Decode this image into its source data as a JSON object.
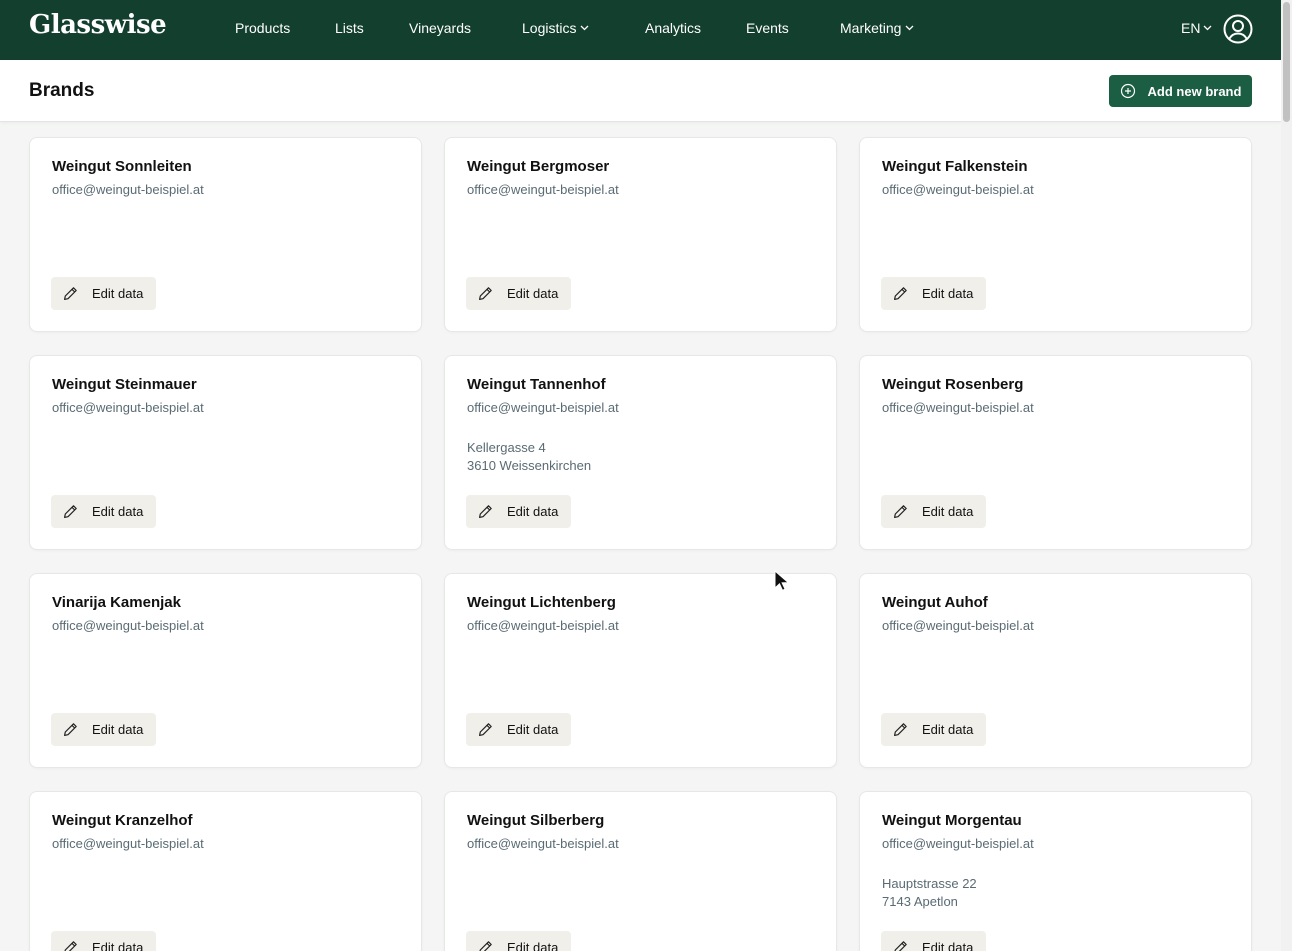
{
  "app": {
    "logo": "Glasswise"
  },
  "nav": {
    "items": [
      {
        "label": "Products",
        "has_menu": false
      },
      {
        "label": "Lists",
        "has_menu": false
      },
      {
        "label": "Vineyards",
        "has_menu": false
      },
      {
        "label": "Logistics",
        "has_menu": true
      },
      {
        "label": "Analytics",
        "has_menu": false
      },
      {
        "label": "Events",
        "has_menu": false
      },
      {
        "label": "Marketing",
        "has_menu": true
      }
    ],
    "language": "EN",
    "avatar_icon": "user-circle-icon"
  },
  "header": {
    "title": "Brands",
    "add_button_label": "Add new brand",
    "add_button_icon": "plus-circle-icon"
  },
  "colors": {
    "nav_bg": "#133f2e",
    "accent": "#1b5e43",
    "muted_text": "#5a6b74",
    "edit_button_bg": "#f1efe9"
  },
  "edit_label": "Edit data",
  "edit_icon": "pencil-icon",
  "brands": [
    {
      "name": "Weingut Sonnleiten",
      "email": "office@weingut-beispiel.at",
      "address_line1": "",
      "address_line2": ""
    },
    {
      "name": "Weingut Bergmoser",
      "email": "office@weingut-beispiel.at",
      "address_line1": "",
      "address_line2": ""
    },
    {
      "name": "Weingut Falkenstein",
      "email": "office@weingut-beispiel.at",
      "address_line1": "",
      "address_line2": ""
    },
    {
      "name": "Weingut Steinmauer",
      "email": "office@weingut-beispiel.at",
      "address_line1": "",
      "address_line2": ""
    },
    {
      "name": "Weingut Tannenhof",
      "email": "office@weingut-beispiel.at",
      "address_line1": "Kellergasse 4",
      "address_line2": "3610 Weissenkirchen"
    },
    {
      "name": "Weingut Rosenberg",
      "email": "office@weingut-beispiel.at",
      "address_line1": "",
      "address_line2": ""
    },
    {
      "name": "Vinarija Kamenjak",
      "email": "office@weingut-beispiel.at",
      "address_line1": "",
      "address_line2": ""
    },
    {
      "name": "Weingut Lichtenberg",
      "email": "office@weingut-beispiel.at",
      "address_line1": "",
      "address_line2": ""
    },
    {
      "name": "Weingut Auhof",
      "email": "office@weingut-beispiel.at",
      "address_line1": "",
      "address_line2": ""
    },
    {
      "name": "Weingut Kranzelhof",
      "email": "office@weingut-beispiel.at",
      "address_line1": "",
      "address_line2": ""
    },
    {
      "name": "Weingut Silberberg",
      "email": "office@weingut-beispiel.at",
      "address_line1": "",
      "address_line2": ""
    },
    {
      "name": "Weingut Morgentau",
      "email": "office@weingut-beispiel.at",
      "address_line1": "Hauptstrasse 22",
      "address_line2": "7143 Apetlon"
    }
  ]
}
